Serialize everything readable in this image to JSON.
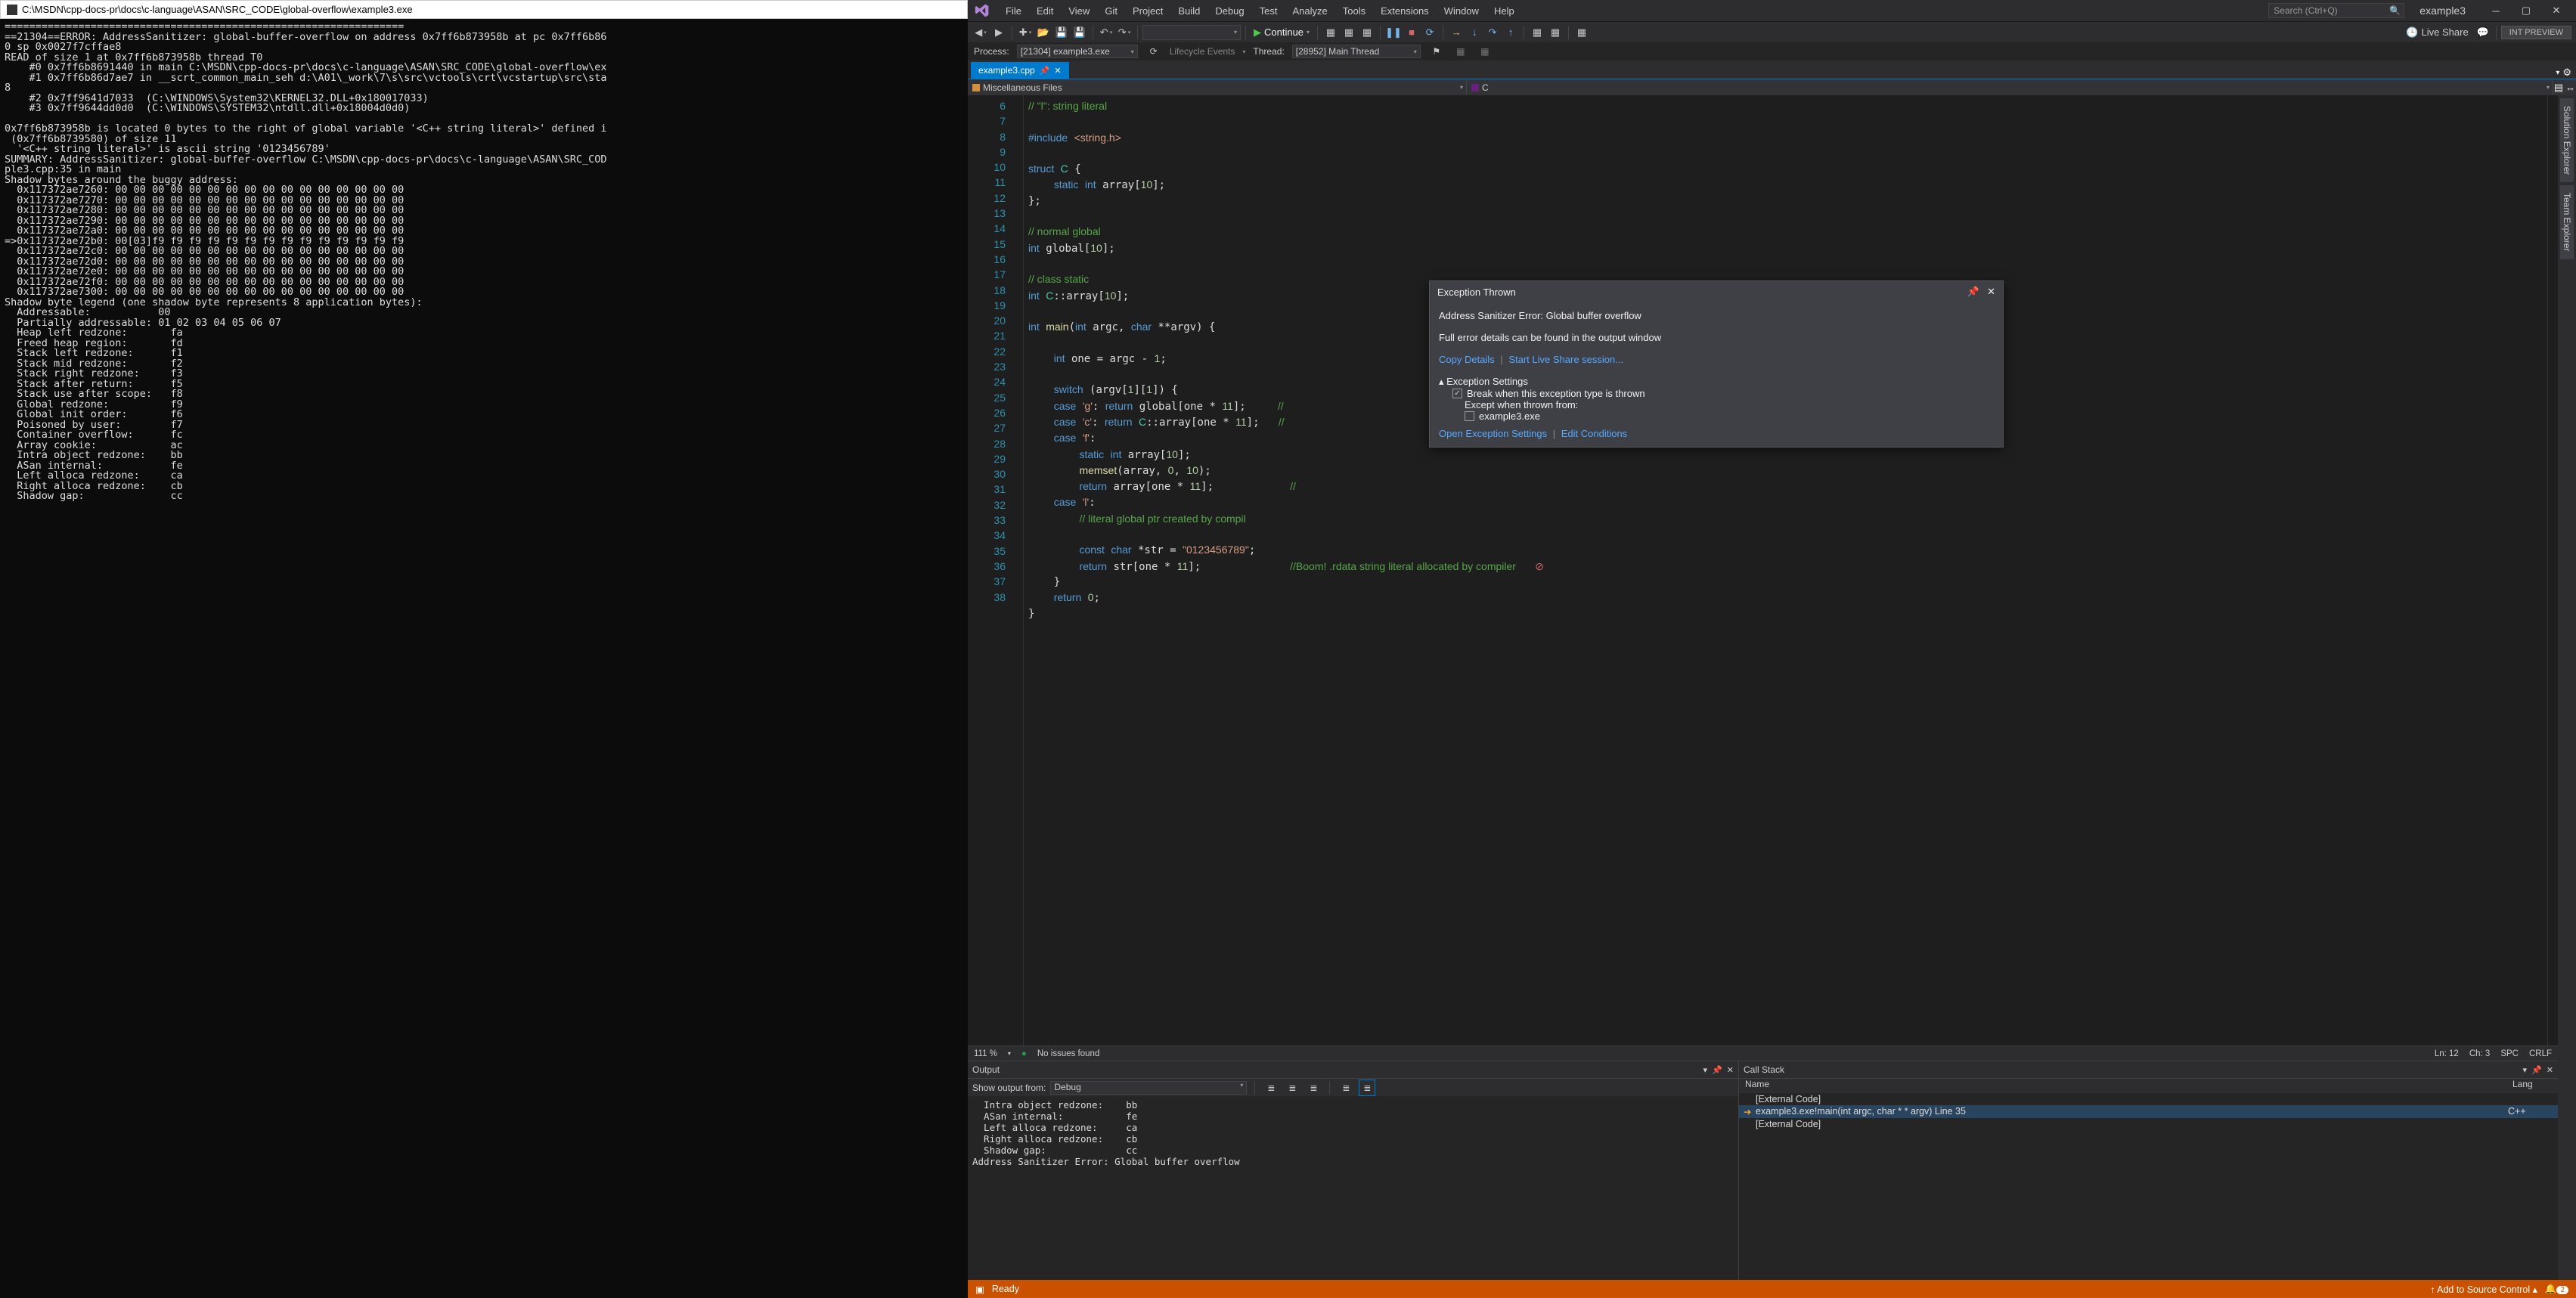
{
  "console": {
    "title_path": "C:\\MSDN\\cpp-docs-pr\\docs\\c-language\\ASAN\\SRC_CODE\\global-overflow\\example3.exe",
    "body": "=================================================================\n==21304==ERROR: AddressSanitizer: global-buffer-overflow on address 0x7ff6b873958b at pc 0x7ff6b86\n0 sp 0x0027f7cffae8\nREAD of size 1 at 0x7ff6b873958b thread T0\n    #0 0x7ff6b8691440 in main C:\\MSDN\\cpp-docs-pr\\docs\\c-language\\ASAN\\SRC_CODE\\global-overflow\\ex\n    #1 0x7ff6b86d7ae7 in __scrt_common_main_seh d:\\A01\\_work\\7\\s\\src\\vctools\\crt\\vcstartup\\src\\sta\n8\n    #2 0x7ff9641d7033  (C:\\WINDOWS\\System32\\KERNEL32.DLL+0x180017033)\n    #3 0x7ff9644dd0d0  (C:\\WINDOWS\\SYSTEM32\\ntdll.dll+0x18004d0d0)\n\n0x7ff6b873958b is located 0 bytes to the right of global variable '<C++ string literal>' defined i\n (0x7ff6b8739580) of size 11\n  '<C++ string literal>' is ascii string '0123456789'\nSUMMARY: AddressSanitizer: global-buffer-overflow C:\\MSDN\\cpp-docs-pr\\docs\\c-language\\ASAN\\SRC_COD\nple3.cpp:35 in main\nShadow bytes around the buggy address:\n  0x117372ae7260: 00 00 00 00 00 00 00 00 00 00 00 00 00 00 00 00\n  0x117372ae7270: 00 00 00 00 00 00 00 00 00 00 00 00 00 00 00 00\n  0x117372ae7280: 00 00 00 00 00 00 00 00 00 00 00 00 00 00 00 00\n  0x117372ae7290: 00 00 00 00 00 00 00 00 00 00 00 00 00 00 00 00\n  0x117372ae72a0: 00 00 00 00 00 00 00 00 00 00 00 00 00 00 00 00\n=>0x117372ae72b0: 00[03]f9 f9 f9 f9 f9 f9 f9 f9 f9 f9 f9 f9 f9 f9\n  0x117372ae72c0: 00 00 00 00 00 00 00 00 00 00 00 00 00 00 00 00\n  0x117372ae72d0: 00 00 00 00 00 00 00 00 00 00 00 00 00 00 00 00\n  0x117372ae72e0: 00 00 00 00 00 00 00 00 00 00 00 00 00 00 00 00\n  0x117372ae72f0: 00 00 00 00 00 00 00 00 00 00 00 00 00 00 00 00\n  0x117372ae7300: 00 00 00 00 00 00 00 00 00 00 00 00 00 00 00 00\nShadow byte legend (one shadow byte represents 8 application bytes):\n  Addressable:           00\n  Partially addressable: 01 02 03 04 05 06 07\n  Heap left redzone:       fa\n  Freed heap region:       fd\n  Stack left redzone:      f1\n  Stack mid redzone:       f2\n  Stack right redzone:     f3\n  Stack after return:      f5\n  Stack use after scope:   f8\n  Global redzone:          f9\n  Global init order:       f6\n  Poisoned by user:        f7\n  Container overflow:      fc\n  Array cookie:            ac\n  Intra object redzone:    bb\n  ASan internal:           fe\n  Left alloca redzone:     ca\n  Right alloca redzone:    cb\n  Shadow gap:              cc"
  },
  "vs": {
    "menu": [
      "File",
      "Edit",
      "View",
      "Git",
      "Project",
      "Build",
      "Debug",
      "Test",
      "Analyze",
      "Tools",
      "Extensions",
      "Window",
      "Help"
    ],
    "search_placeholder": "Search (Ctrl+Q)",
    "solution_name": "example3",
    "toolbar": {
      "continue": "Continue",
      "liveshare": "Live Share",
      "intpreview": "INT PREVIEW"
    },
    "procbar": {
      "process_label": "Process:",
      "process_value": "[21304] example3.exe",
      "lifecycle": "Lifecycle Events",
      "thread_label": "Thread:",
      "thread_value": "[28952] Main Thread"
    },
    "tab": {
      "name": "example3.cpp"
    },
    "navbar": {
      "left": "Miscellaneous Files",
      "right": "C"
    },
    "gutter_lines": [
      "6",
      "7",
      "8",
      "9",
      "10",
      "11",
      "12",
      "13",
      "14",
      "15",
      "16",
      "17",
      "18",
      "19",
      "20",
      "21",
      "22",
      "23",
      "24",
      "25",
      "26",
      "27",
      "28",
      "29",
      "30",
      "31",
      "32",
      "33",
      "34",
      "35",
      "36",
      "37",
      "38"
    ],
    "ed_status": {
      "zoom": "111 %",
      "issues": "No issues found",
      "ln": "Ln: 12",
      "ch": "Ch: 3",
      "spc": "SPC",
      "crlf": "CRLF"
    },
    "exc": {
      "title": "Exception Thrown",
      "line1": "Address Sanitizer Error: Global buffer overflow",
      "line2": "Full error details can be found in the output window",
      "copy": "Copy Details",
      "startls": "Start Live Share session...",
      "settings_hdr": "Exception Settings",
      "break_when": "Break when this exception type is thrown",
      "except_when": "Except when thrown from:",
      "exe": "example3.exe",
      "open_settings": "Open Exception Settings",
      "edit_cond": "Edit Conditions"
    },
    "output": {
      "title": "Output",
      "show_from": "Show output from:",
      "combo": "Debug",
      "body": "  Intra object redzone:    bb\n  ASan internal:           fe\n  Left alloca redzone:     ca\n  Right alloca redzone:    cb\n  Shadow gap:              cc\nAddress Sanitizer Error: Global buffer overflow\n"
    },
    "callstack": {
      "title": "Call Stack",
      "col_name": "Name",
      "col_lang": "Lang",
      "rows": [
        {
          "name": "[External Code]",
          "lang": ""
        },
        {
          "name": "example3.exe!main(int argc, char * * argv) Line 35",
          "lang": "C++"
        },
        {
          "name": "[External Code]",
          "lang": ""
        }
      ]
    },
    "side": {
      "sol": "Solution Explorer",
      "team": "Team Explorer"
    },
    "status": {
      "ready": "Ready",
      "scm": "Add to Source Control",
      "notif": "2"
    }
  }
}
